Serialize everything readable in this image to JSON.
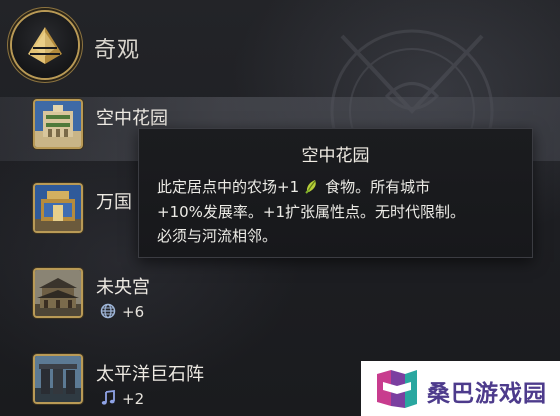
{
  "category": {
    "title": "奇观",
    "icon": "pyramid-icon"
  },
  "wonders": [
    {
      "name": "空中花园",
      "selected": true,
      "yield_icon": null,
      "yield_value": null
    },
    {
      "name": "万国",
      "selected": false,
      "yield_icon": null,
      "yield_value": null
    },
    {
      "name": "未央宫",
      "selected": false,
      "yield_icon": "globe-icon",
      "yield_value": "+6"
    },
    {
      "name": "太平洋巨石阵",
      "selected": false,
      "yield_icon": "music-note-icon",
      "yield_value": "+2"
    }
  ],
  "tooltip": {
    "title": "空中花园",
    "line1_pre": "此定居点中的农场+1",
    "line1_icon": "food-icon",
    "line1_post": "食物。所有城市",
    "line2": "+10%发展率。+1扩张属性点。无时代限制。",
    "line3": "必须与河流相邻。"
  },
  "watermark": {
    "text": "桑巴游戏园"
  },
  "colors": {
    "gold_border": "#b99a56",
    "background": "#1c1d20",
    "tooltip_bg": "#1b1c1f",
    "watermark_text": "#4d3b8c",
    "food_green": "#7fae2a"
  }
}
